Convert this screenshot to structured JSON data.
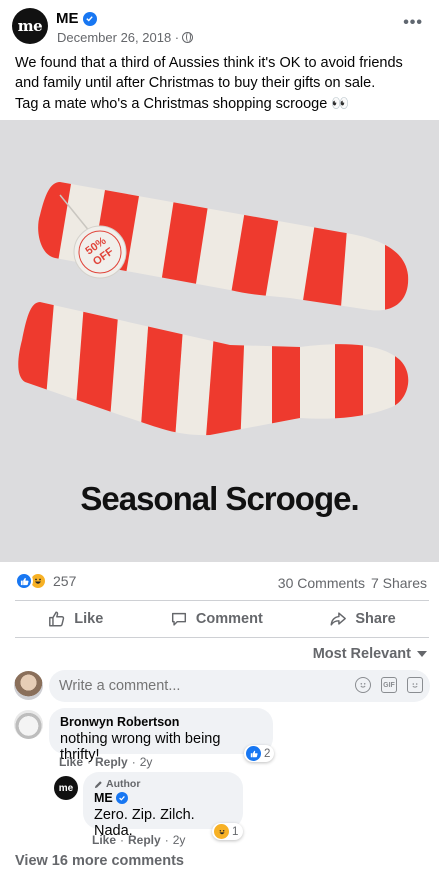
{
  "post": {
    "page_name": "ME",
    "logo_text": "me",
    "date": "December 26, 2018 ·",
    "text_line1": "We found that a third of Aussies think it's OK to avoid friends and family until after Christmas to buy their gifts on sale.",
    "text_line2": "Tag a mate who's a Christmas shopping scrooge 👀",
    "more_label": "•••"
  },
  "image": {
    "headline": "Seasonal Scrooge.",
    "tag_line1": "50%",
    "tag_line2": "OFF"
  },
  "stats": {
    "reaction_count": "257",
    "comments": "30 Comments",
    "shares": "7 Shares"
  },
  "actions": {
    "like": "Like",
    "comment": "Comment",
    "share": "Share"
  },
  "sort": {
    "label": "Most Relevant"
  },
  "composer": {
    "placeholder": "Write a comment..."
  },
  "comments": [
    {
      "author": "Bronwyn Robertson",
      "text": "nothing wrong with being thrifty!",
      "like": "Like",
      "reply": "Reply",
      "age": "2y",
      "reaction_count": "2"
    },
    {
      "author_tag": "Author",
      "author": "ME",
      "avatar_text": "me",
      "text": "Zero. Zip. Zilch. Nada.",
      "like": "Like",
      "reply": "Reply",
      "age": "2y",
      "reaction_count": "1"
    }
  ],
  "view_more": "View 16 more comments",
  "colors": {
    "facebook_blue": "#1877f2",
    "sock_red": "#ee3a2e",
    "sock_cream": "#eeeae3",
    "image_bg": "#dcdcde"
  }
}
